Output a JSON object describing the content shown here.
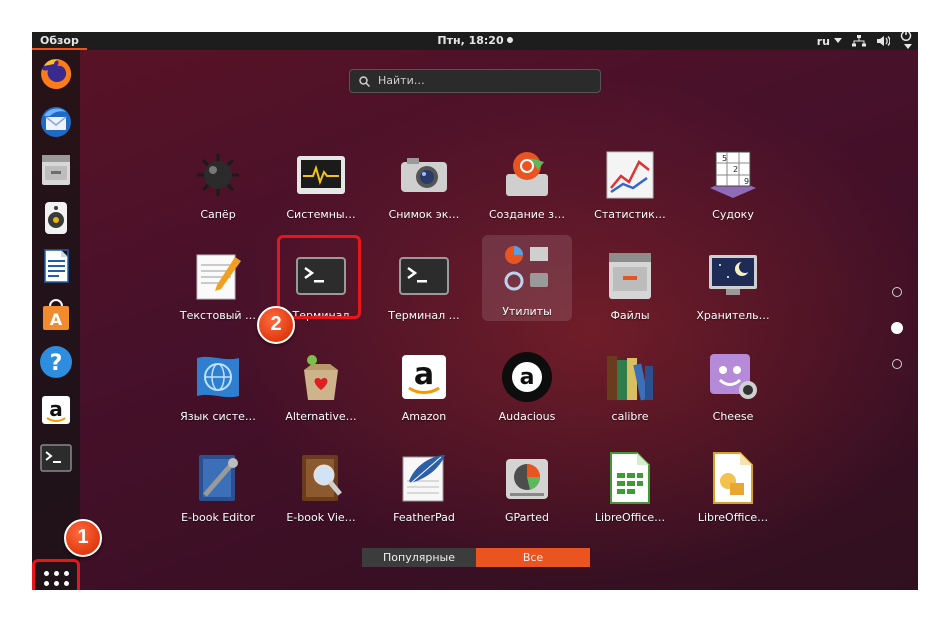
{
  "topbar": {
    "overview": "Обзор",
    "clock": "Птн, 18:20",
    "lang": "ru"
  },
  "dock": {
    "items": [
      "firefox-icon",
      "thunderbird-icon",
      "files-icon",
      "rhythmbox-icon",
      "writer-icon",
      "software-icon",
      "help-icon",
      "amazon-icon",
      "terminal-icon"
    ]
  },
  "search": {
    "placeholder": "Найти…"
  },
  "apps": [
    {
      "label": "Сапёр",
      "icon": "mines-icon"
    },
    {
      "label": "Системны…",
      "icon": "system-monitor-icon"
    },
    {
      "label": "Снимок эк…",
      "icon": "screenshot-icon"
    },
    {
      "label": "Создание з…",
      "icon": "startup-disk-icon"
    },
    {
      "label": "Статистик…",
      "icon": "statistics-icon"
    },
    {
      "label": "Судоку",
      "icon": "sudoku-icon"
    },
    {
      "label": "Текстовый …",
      "icon": "text-editor-icon"
    },
    {
      "label": "Терминал",
      "icon": "terminal-icon"
    },
    {
      "label": "Терминал …",
      "icon": "terminal-icon"
    },
    {
      "label": "Утилиты",
      "icon": "utilities-folder-icon"
    },
    {
      "label": "Файлы",
      "icon": "files-icon"
    },
    {
      "label": "Хранитель…",
      "icon": "screensaver-icon"
    },
    {
      "label": "Язык систе…",
      "icon": "language-icon"
    },
    {
      "label": "Alternative…",
      "icon": "alternatives-icon"
    },
    {
      "label": "Amazon",
      "icon": "amazon-icon"
    },
    {
      "label": "Audacious",
      "icon": "audacious-icon"
    },
    {
      "label": "calibre",
      "icon": "calibre-icon"
    },
    {
      "label": "Cheese",
      "icon": "cheese-icon"
    },
    {
      "label": "E-book Editor",
      "icon": "ebook-editor-icon"
    },
    {
      "label": "E-book Vie…",
      "icon": "ebook-viewer-icon"
    },
    {
      "label": "FeatherPad",
      "icon": "featherpad-icon"
    },
    {
      "label": "GParted",
      "icon": "gparted-icon"
    },
    {
      "label": "LibreOffice…",
      "icon": "libreoffice-calc-icon"
    },
    {
      "label": "LibreOffice…",
      "icon": "libreoffice-draw-icon"
    }
  ],
  "pager": {
    "pages": 3,
    "active": 2
  },
  "tabs": {
    "popular": "Популярные",
    "all": "Все"
  },
  "badges": {
    "one": "1",
    "two": "2"
  },
  "colors": {
    "accent": "#e95420",
    "highlight": "#e8151b"
  }
}
